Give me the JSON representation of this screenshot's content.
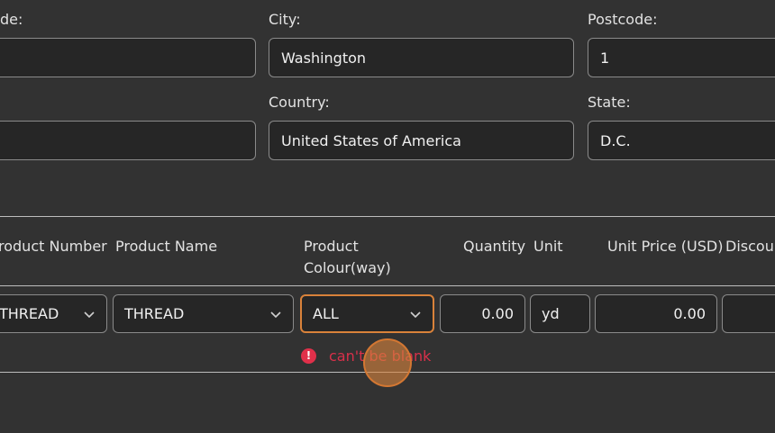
{
  "address": {
    "partial_label": "de:",
    "city_label": "City:",
    "city_value": "Washington",
    "postcode_label": "Postcode:",
    "postcode_value": "1",
    "country_label": "Country:",
    "country_value": "United States of America",
    "state_label": "State:",
    "state_value": "D.C."
  },
  "table": {
    "headers": {
      "product_number": "roduct Number",
      "product_name": "Product Name",
      "product_colour_line1": "Product",
      "product_colour_line2": "Colour(way)",
      "quantity": "Quantity",
      "unit": "Unit",
      "unit_price": "Unit Price (USD)",
      "discount": "Discoun"
    },
    "row": {
      "product_number": "THREAD",
      "product_name": "THREAD",
      "product_colour": "ALL",
      "quantity": "0.00",
      "unit": "yd",
      "unit_price": "0.00",
      "discount": ""
    },
    "error_message": "can't be blank"
  },
  "colors": {
    "background": "#323232",
    "field_background": "#262626",
    "field_border": "#8a8a8a",
    "focus_border": "#d9823a",
    "error": "#d8304a"
  },
  "icons": {
    "dropdown": "chevron-down-icon",
    "error": "exclamation-circle-icon"
  }
}
